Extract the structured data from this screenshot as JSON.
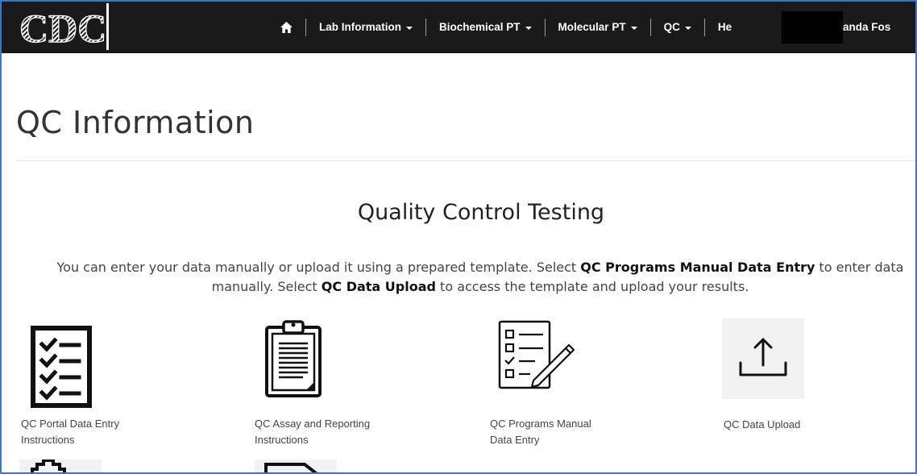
{
  "header": {
    "logo_text": "CDC",
    "nav": [
      {
        "label": "Lab Information"
      },
      {
        "label": "Biochemical PT"
      },
      {
        "label": "Molecular PT"
      },
      {
        "label": "QC"
      },
      {
        "label": "He"
      }
    ],
    "user_name": "anda Fos"
  },
  "page": {
    "title": "QC Information",
    "section_heading": "Quality Control Testing",
    "intro": {
      "p1": "You can enter your data manually or upload it using a prepared template. Select ",
      "b1": "QC Programs Manual Data Entry",
      "p2": " to enter data manually. Select ",
      "b2": "QC Data Upload",
      "p3": " to access the template and upload your results."
    }
  },
  "tiles": [
    {
      "label": "QC Portal Data Entry Instructions",
      "icon": "checklist-icon"
    },
    {
      "label": "QC Assay and Reporting Instructions",
      "icon": "clipboard-icon"
    },
    {
      "label": "QC Programs Manual Data Entry",
      "icon": "form-pencil-icon"
    },
    {
      "label": "QC Data Upload",
      "icon": "upload-icon"
    }
  ],
  "colors": {
    "navbar": "#1a1a1a",
    "frame_border": "#4472c4",
    "upload_tile_bg": "#f2f2f2"
  }
}
